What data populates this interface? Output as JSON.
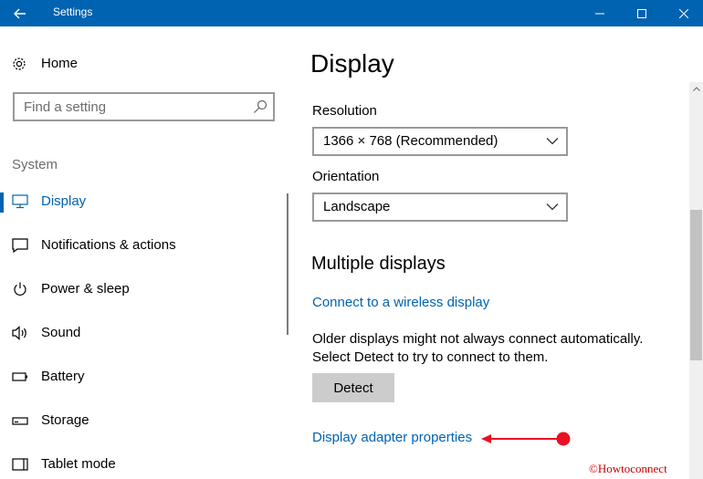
{
  "window": {
    "title": "Settings"
  },
  "sidebar": {
    "home_label": "Home",
    "search_placeholder": "Find a setting",
    "group_label": "System",
    "items": [
      {
        "label": "Display",
        "icon": "monitor-icon",
        "active": true
      },
      {
        "label": "Notifications & actions",
        "icon": "notification-icon",
        "active": false
      },
      {
        "label": "Power & sleep",
        "icon": "power-icon",
        "active": false
      },
      {
        "label": "Sound",
        "icon": "speaker-icon",
        "active": false
      },
      {
        "label": "Battery",
        "icon": "battery-icon",
        "active": false
      },
      {
        "label": "Storage",
        "icon": "storage-icon",
        "active": false
      },
      {
        "label": "Tablet mode",
        "icon": "tablet-icon",
        "active": false
      }
    ]
  },
  "main": {
    "title": "Display",
    "resolution": {
      "label": "Resolution",
      "value": "1366 × 768 (Recommended)"
    },
    "orientation": {
      "label": "Orientation",
      "value": "Landscape"
    },
    "multiple_displays": {
      "heading": "Multiple displays",
      "wireless_link": "Connect to a wireless display",
      "description_line1": "Older displays might not always connect automatically.",
      "description_line2": "Select Detect to try to connect to them.",
      "detect_button": "Detect",
      "adapter_link": "Display adapter properties"
    }
  },
  "watermark": "©Howtoconnect",
  "colors": {
    "accent": "#0063b1",
    "annotation": "#e81123",
    "watermark": "#cc0000"
  }
}
